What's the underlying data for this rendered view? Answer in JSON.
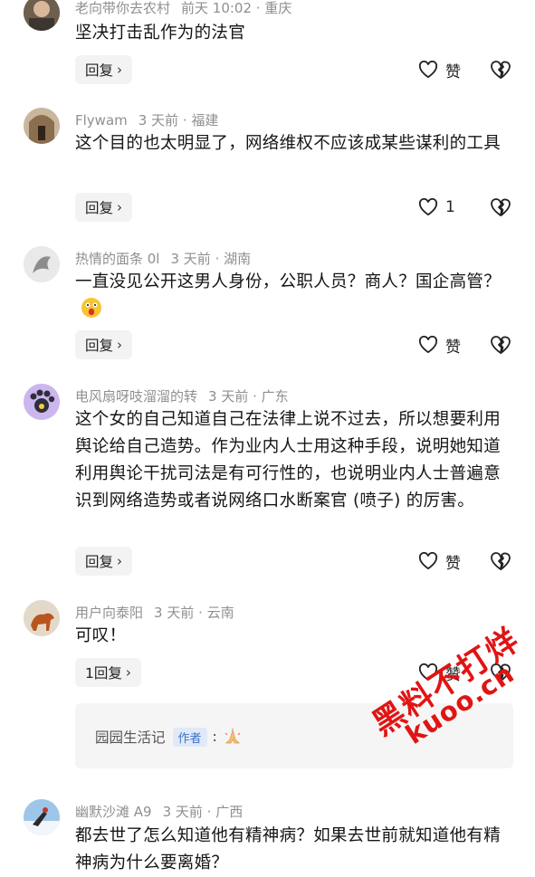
{
  "comments": [
    {
      "username": "老向带你去农村",
      "time_location": "前天 10:02 · 重庆",
      "text": "坚决打击乱作为的法官",
      "reply_label": "回复",
      "like_label": "赞"
    },
    {
      "username": "Flywam",
      "time_location": "3 天前 · 福建",
      "text": "这个目的也太明显了，网络维权不应该成某些谋利的工具",
      "reply_label": "回复",
      "like_label": "1"
    },
    {
      "username": "热情的面条 0l",
      "time_location": "3 天前 · 湖南",
      "text": "一直没见公开这男人身份，公职人员？商人？国企高管？",
      "reply_label": "回复",
      "like_label": "赞"
    },
    {
      "username": "电风扇呀吱溜溜的转",
      "time_location": "3 天前 · 广东",
      "text": "这个女的自己知道自己在法律上说不过去，所以想要利用舆论给自己造势。作为业内人士用这种手段，说明她知道利用舆论干扰司法是有可行性的，也说明业内人士普遍意识到网络造势或者说网络口水断案官 (喷子) 的厉害。",
      "reply_label": "回复",
      "like_label": "赞"
    },
    {
      "username": "用户向泰阳",
      "time_location": "3 天前 · 云南",
      "text": "可叹！",
      "reply_label": "1回复",
      "like_label": "赞",
      "sub_reply": {
        "username": "园园生活记",
        "author_tag": "作者",
        "colon": ":"
      }
    },
    {
      "username": "幽默沙滩 A9",
      "time_location": "3 天前 · 广西",
      "text": "都去世了怎么知道他有精神病？如果去世前就知道他有精神病为什么要离婚？"
    }
  ],
  "watermark": {
    "line1": "黑料不打烊",
    "line2": "kuoo.cn"
  },
  "colors": {
    "watermark": "#e11414",
    "author_tag_text": "#3b73c9",
    "author_tag_bg": "#dfe9f8"
  }
}
